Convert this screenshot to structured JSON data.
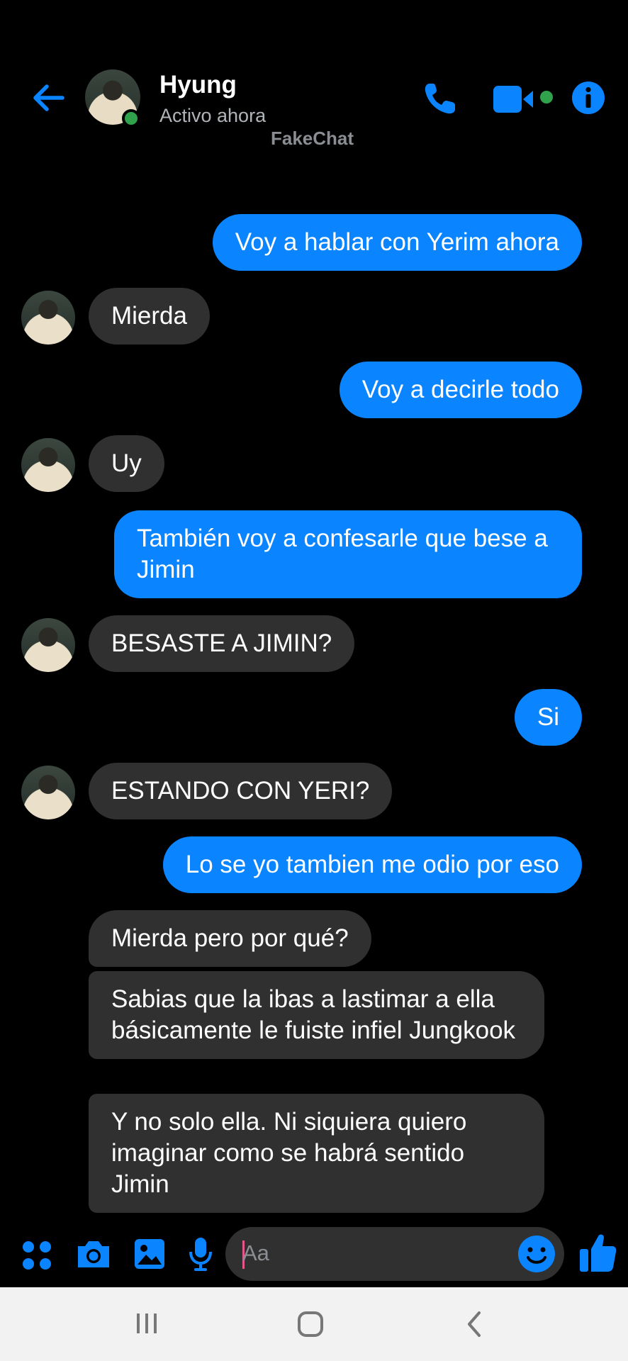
{
  "header": {
    "contact_name": "Hyung",
    "status": "Activo ahora",
    "watermark": "FakeChat",
    "icons": [
      "back-arrow-icon",
      "phone-icon",
      "video-camera-icon",
      "info-icon"
    ]
  },
  "messages": [
    {
      "side": "out",
      "text": "Voy a hablar con Yerim ahora"
    },
    {
      "side": "in",
      "text": "Mierda"
    },
    {
      "side": "out",
      "text": "Voy a decirle todo"
    },
    {
      "side": "in",
      "text": "Uy"
    },
    {
      "side": "out",
      "text": "También voy a confesarle que bese a Jimin"
    },
    {
      "side": "in",
      "text": "BESASTE A JIMIN?"
    },
    {
      "side": "out",
      "text": "Si"
    },
    {
      "side": "in",
      "text": "ESTANDO CON YERI?"
    },
    {
      "side": "out",
      "text": "Lo se yo tambien me odio por eso"
    },
    {
      "side": "in",
      "text": "Mierda pero por qué?"
    },
    {
      "side": "in",
      "text": "Sabias que la ibas a lastimar a ella básicamente le fuiste infiel Jungkook"
    },
    {
      "side": "in",
      "text": "Y no solo ella. Ni siquiera quiero imaginar como se habrá sentido Jimin"
    }
  ],
  "composer": {
    "placeholder": "Aa",
    "icons": [
      "apps-grid-icon",
      "camera-icon",
      "gallery-icon",
      "microphone-icon",
      "emoji-icon",
      "thumbs-up-icon"
    ]
  },
  "colors": {
    "accent": "#0a84ff",
    "background": "#000000",
    "incoming_bubble": "#303030",
    "online": "#31a24c"
  }
}
